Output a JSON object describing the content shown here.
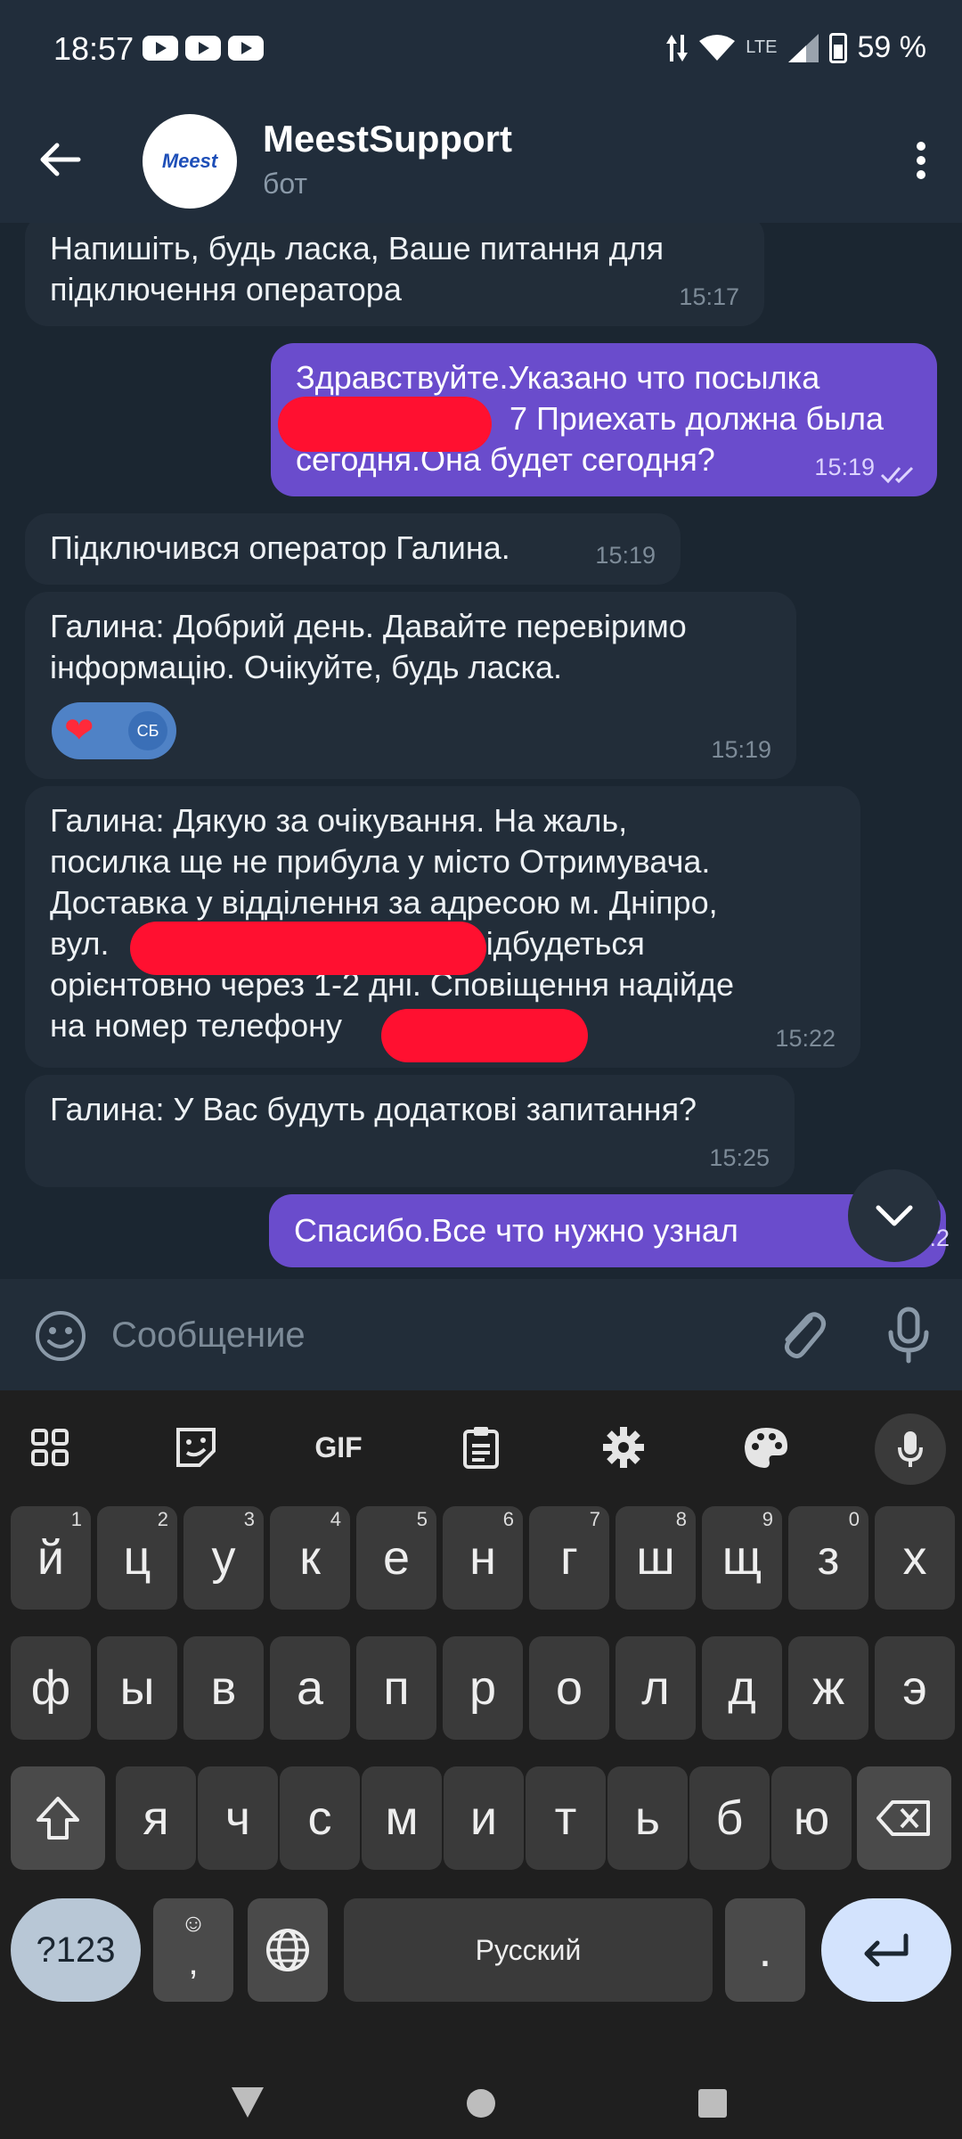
{
  "status_bar": {
    "time": "18:57",
    "network": "LTE",
    "battery": "59 %"
  },
  "header": {
    "avatar_text": "Meest",
    "title": "MeestSupport",
    "subtitle": "бот"
  },
  "messages": [
    {
      "direction": "in",
      "text_lines": [
        "Напишіть, будь ласка, Ваше питання для",
        "підключення оператора"
      ],
      "time": "15:17"
    },
    {
      "direction": "out",
      "text_lines": [
        "Здравствуйте.Указано что посылка",
        "7 Приехать должна была",
        "сегодня.Она будет сегодня?"
      ],
      "time": "15:19",
      "status": "read"
    },
    {
      "direction": "in",
      "text_lines": [
        "Підключився оператор Галина."
      ],
      "time": "15:19"
    },
    {
      "direction": "in",
      "text_lines": [
        "Галина: Добрий день. Давайте перевіримо",
        "інформацію. Очікуйте, будь ласка."
      ],
      "time": "15:19",
      "reaction": {
        "emoji": "❤",
        "user": "СБ"
      }
    },
    {
      "direction": "in",
      "text_lines": [
        "Галина: Дякую за очікування. На жаль,",
        "посилка ще не прибула у місто Отримувача.",
        "Доставка у відділення за адресою м. Дніпро,",
        "вул.",
        "відбудеться",
        "орієнтовно через 1-2 дні. Сповіщення  надійде",
        "на номер телефону"
      ],
      "time": "15:22"
    },
    {
      "direction": "in",
      "text_lines": [
        "Галина: У Вас будуть додаткові запитання?"
      ],
      "time": "15:25"
    },
    {
      "direction": "out",
      "text_lines": [
        "Спасибо.Все что нужно узнал"
      ],
      "time": "15:2"
    }
  ],
  "composer": {
    "placeholder": "Сообщение"
  },
  "keyboard": {
    "row1": [
      "й",
      "ц",
      "у",
      "к",
      "е",
      "н",
      "г",
      "ш",
      "щ",
      "з",
      "х"
    ],
    "row1_hints": [
      "1",
      "2",
      "3",
      "4",
      "5",
      "6",
      "7",
      "8",
      "9",
      "0"
    ],
    "row2": [
      "ф",
      "ы",
      "в",
      "а",
      "п",
      "р",
      "о",
      "л",
      "д",
      "ж",
      "э"
    ],
    "row3": [
      "я",
      "ч",
      "с",
      "м",
      "и",
      "т",
      "ь",
      "б",
      "ю"
    ],
    "sym_label": "?123",
    "comma_label": ",",
    "space_label": "Русский",
    "period_label": ".",
    "gif_label": "GIF"
  }
}
